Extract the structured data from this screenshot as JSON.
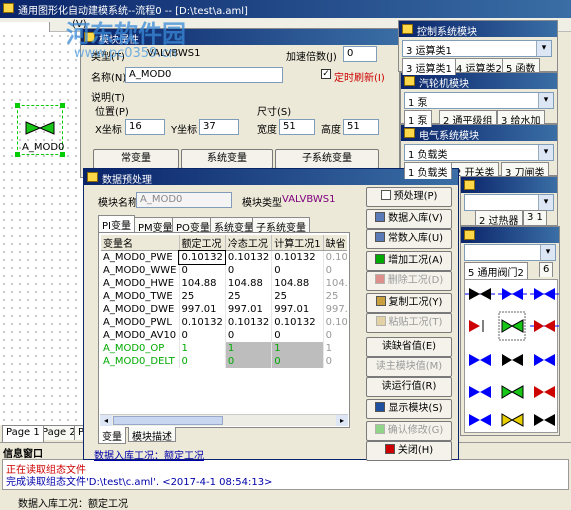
{
  "main_window": {
    "title": "通用图形化自动建模系统--流程0 -- [D:\\test\\a.aml]",
    "menu_fragment": "(V)"
  },
  "watermark": {
    "line1": "河东软件园",
    "line2": "www.pc0359.cn"
  },
  "canvas": {
    "node_label": "A_MOD0",
    "page_tabs": [
      "Page 1",
      "Page 2",
      "P"
    ]
  },
  "info_panel": {
    "title": "信息窗口",
    "lines": [
      "正在读取组态文件",
      "完成读取组态文件'D:\\test\\c.aml'. <2017-4-1 08:54:13>"
    ],
    "status": "数据入库工况：额定工况"
  },
  "module_props": {
    "title": "模块属性",
    "type_label": "类型(T)",
    "type_value": "VALVBWS1",
    "accel_label": "加速倍数(J)",
    "accel_value": "0",
    "name_label": "名称(N)",
    "name_value": "A_MOD0",
    "timer_label": "定时刷新(I)",
    "desc_label": "说明(T)",
    "pos_label": "位置(P)",
    "x_label": "X坐标",
    "x_value": "16",
    "y_label": "Y坐标",
    "y_value": "37",
    "size_label": "尺寸(S)",
    "w_label": "宽度",
    "w_value": "51",
    "h_label": "高度",
    "h_value": "51",
    "var_buttons": [
      "常变量",
      "系统变量",
      "子系统变量"
    ]
  },
  "palettes": [
    {
      "title": "控制系统模块",
      "select": "3 运算类1",
      "tabs": [
        "3 运算类1",
        "4 运算类2",
        "5 函数"
      ]
    },
    {
      "title": "汽轮机模块",
      "select": "1 泵",
      "tabs": [
        "1 泵",
        "2 通平级组",
        "3 给水加"
      ]
    },
    {
      "title": "电气系统模块",
      "select": "1 负载类",
      "tabs": [
        "1 负载类",
        "2 开关类",
        "3 刀闸类"
      ]
    },
    {
      "title": "",
      "select": "",
      "tabs": [
        "2 过热器",
        "3 1"
      ]
    },
    {
      "title": "",
      "select": "",
      "tabs": [
        "5 通用阀门2",
        "6"
      ]
    }
  ],
  "preprocess": {
    "title": "数据预处理",
    "module_name_label": "模块名称",
    "module_name_value": "A_MOD0",
    "module_type_label": "模块类型",
    "module_type_value": "VALVBWS1",
    "tabs": [
      "PI变量",
      "PM变量",
      "PO变量",
      "系统变量",
      "子系统变量"
    ],
    "columns": [
      "变量名",
      "额定工况",
      "冷态工况",
      "计算工况1",
      "缺省"
    ],
    "rows": [
      {
        "name": "A_MOD0_PWE",
        "v1": "0.10132",
        "v2": "0.10132",
        "v3": "0.10132",
        "v4": "0.10",
        "green": false
      },
      {
        "name": "A_MOD0_WWE",
        "v1": "0",
        "v2": "0",
        "v3": "0",
        "v4": "0",
        "green": false
      },
      {
        "name": "A_MOD0_HWE",
        "v1": "104.88",
        "v2": "104.88",
        "v3": "104.88",
        "v4": "104.",
        "green": false
      },
      {
        "name": "A_MOD0_TWE",
        "v1": "25",
        "v2": "25",
        "v3": "25",
        "v4": "25",
        "green": false
      },
      {
        "name": "A_MOD0_DWE",
        "v1": "997.01",
        "v2": "997.01",
        "v3": "997.01",
        "v4": "997.",
        "green": false
      },
      {
        "name": "A_MOD0_PWL",
        "v1": "0.10132",
        "v2": "0.10132",
        "v3": "0.10132",
        "v4": "0.10",
        "green": false
      },
      {
        "name": "A_MOD0_AV10",
        "v1": "0",
        "v2": "0",
        "v3": "0",
        "v4": "0",
        "green": false
      },
      {
        "name": "A_MOD0_OP",
        "v1": "1",
        "v2": "1",
        "v3": "1",
        "v4": "1",
        "green": true
      },
      {
        "name": "A_MOD0_DELT",
        "v1": "0",
        "v2": "0",
        "v3": "0",
        "v4": "0",
        "green": true
      }
    ],
    "bottom_tabs": [
      "变量",
      "模块描述"
    ],
    "status": "数据入库工况：额定工况",
    "buttons": [
      {
        "label": "预处理(P)",
        "enabled": true
      },
      {
        "label": "数据入库(V)",
        "enabled": true
      },
      {
        "label": "常数入库(U)",
        "enabled": true
      },
      {
        "label": "增加工况(A)",
        "enabled": true
      },
      {
        "label": "删除工况(D)",
        "enabled": false
      },
      {
        "label": "复制工况(Y)",
        "enabled": true
      },
      {
        "label": "粘贴工况(T)",
        "enabled": false
      },
      {
        "label": "读缺省值(E)",
        "enabled": true
      },
      {
        "label": "读主模块值(M)",
        "enabled": false
      },
      {
        "label": "读运行值(R)",
        "enabled": true
      },
      {
        "label": "显示模块(S)",
        "enabled": true
      },
      {
        "label": "确认修改(G)",
        "enabled": false
      },
      {
        "label": "关闭(H)",
        "enabled": true
      }
    ]
  }
}
